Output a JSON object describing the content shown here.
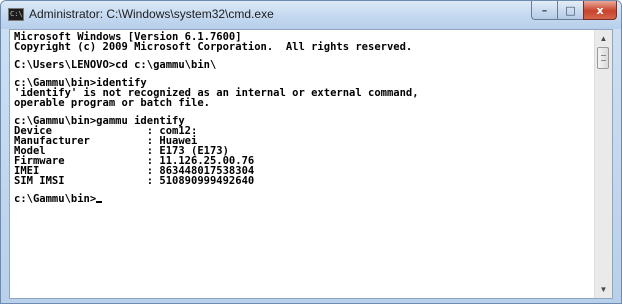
{
  "window": {
    "title": "Administrator: C:\\Windows\\system32\\cmd.exe",
    "icon": "cmd-icon",
    "icon_text": "C:\\",
    "buttons": {
      "minimize": "–",
      "maximize": "□",
      "close": "x"
    }
  },
  "console": {
    "lines": [
      "Microsoft Windows [Version 6.1.7600]",
      "Copyright (c) 2009 Microsoft Corporation.  All rights reserved.",
      "",
      "C:\\Users\\LENOVO>cd c:\\gammu\\bin\\",
      "",
      "c:\\Gammu\\bin>identify",
      "'identify' is not recognized as an internal or external command,",
      "operable program or batch file.",
      "",
      "c:\\Gammu\\bin>gammu identify",
      "Device               : com12:",
      "Manufacturer         : Huawei",
      "Model                : E173 (E173)",
      "Firmware             : 11.126.25.00.76",
      "IMEI                 : 863448017538304",
      "SIM IMSI             : 510890999492640",
      "",
      "c:\\Gammu\\bin>"
    ]
  },
  "scrollbar": {
    "up_icon": "scroll-up-arrow-icon",
    "down_icon": "scroll-down-arrow-icon"
  }
}
